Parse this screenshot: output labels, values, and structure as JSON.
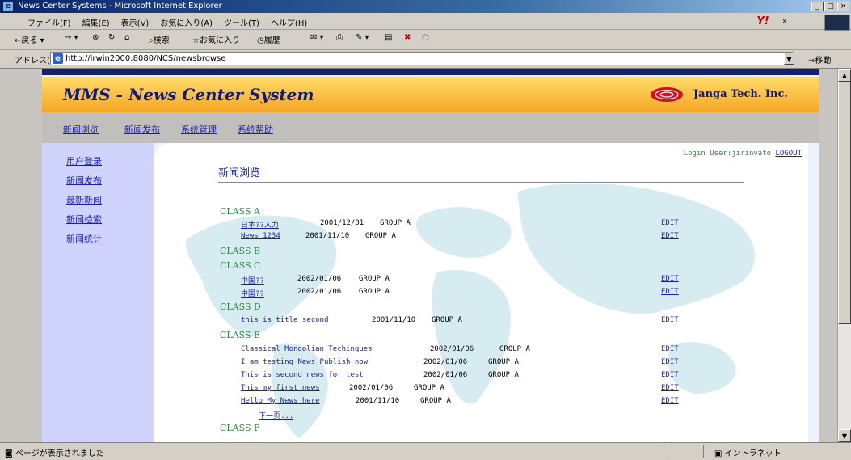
{
  "window": {
    "title": "News Center Systems - Microsoft Internet Explorer",
    "controls": [
      "_",
      "□",
      "×"
    ]
  },
  "menu": [
    "ファイル(F)",
    "編集(E)",
    "表示(V)",
    "お気に入り(A)",
    "ツール(T)",
    "ヘルプ(H)"
  ],
  "toolbar": {
    "back": "←戻る",
    "forward": "→",
    "search": "検索",
    "favorites": "お気に入り",
    "history": "履歴",
    "more": "»"
  },
  "address": {
    "label": "アドレス(D)",
    "url": "http://irwin2000:8080/NCS/newsbrowse",
    "go": "移動"
  },
  "site": {
    "title": "MMS - News Center System",
    "company": "Janga Tech. Inc."
  },
  "nav": [
    "新闻浏览",
    "新闻发布",
    "系统管理",
    "系统帮助"
  ],
  "sidebar": [
    "用户登录",
    "新闻发布",
    "最新新闻",
    "新闻检索",
    "新闻统计"
  ],
  "login": {
    "text": "Login User:jirinvato",
    "logout": "LOGOUT"
  },
  "page_title": "新闻浏览",
  "edit_label": "EDIT",
  "next_label": "下一页...",
  "classes": [
    {
      "name": "CLASS A",
      "items": [
        {
          "title": "日本??入力",
          "date": "2001/12/01",
          "group": "GROUP A"
        },
        {
          "title": "News 1234",
          "date": "2001/11/10",
          "group": "GROUP A"
        }
      ]
    },
    {
      "name": "CLASS B",
      "items": []
    },
    {
      "name": "CLASS C",
      "items": [
        {
          "title": "中国??",
          "date": "2002/01/06",
          "group": "GROUP A"
        },
        {
          "title": "中国??",
          "date": "2002/01/06",
          "group": "GROUP A"
        }
      ]
    },
    {
      "name": "CLASS D",
      "items": [
        {
          "title": "this is title second",
          "date": "2001/11/10",
          "group": "GROUP A"
        }
      ]
    },
    {
      "name": "CLASS E",
      "items": [
        {
          "title": "Classical Mongolian Techinques",
          "date": "2002/01/06",
          "group": "GROUP A"
        },
        {
          "title": "I am testing News Publish now",
          "date": "2002/01/06",
          "group": "GROUP A"
        },
        {
          "title": "This is second news for test",
          "date": "2002/01/06",
          "group": "GROUP A"
        },
        {
          "title": "This my first news",
          "date": "2002/01/06",
          "group": "GROUP A"
        },
        {
          "title": "Hello My News here",
          "date": "2001/11/10",
          "group": "GROUP A"
        }
      ]
    },
    {
      "name": "CLASS F",
      "items": []
    }
  ],
  "status": {
    "text": "ページが表示されました",
    "zone": "イントラネット"
  }
}
